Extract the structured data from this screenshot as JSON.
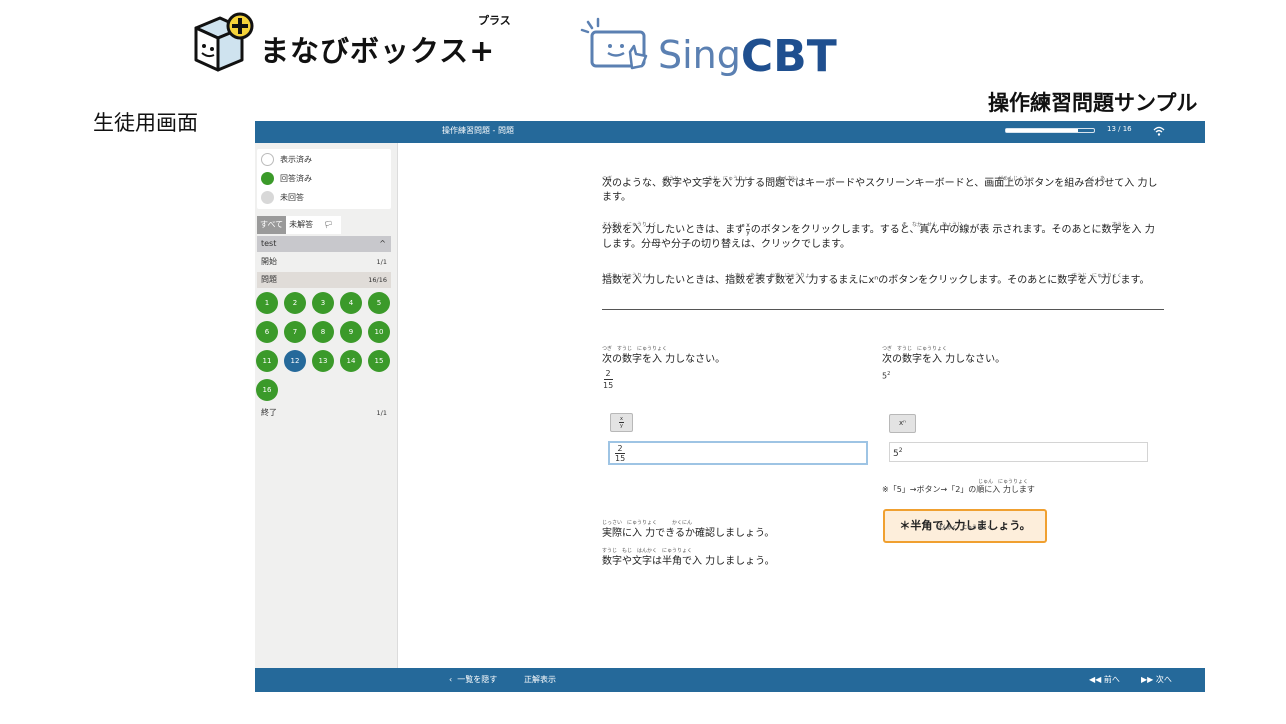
{
  "branding": {
    "manabi_text": "まなびボックス",
    "manabi_plus": "+",
    "manabi_ruby": "プラス",
    "sing_text": "Sing",
    "cbt_text": "CBT"
  },
  "sample_title": "操作練習問題サンプル",
  "student_label": "生徒用画面",
  "topbar": {
    "title": "操作練習問題 - 問題",
    "progress": 0.8125,
    "page_count": "13 / 16"
  },
  "sidebar": {
    "legend": [
      {
        "label": "表示済み",
        "color": "#ffffff"
      },
      {
        "label": "回答済み",
        "color": "#3b9a2a"
      },
      {
        "label": "未回答",
        "color": "#d8d8d8"
      }
    ],
    "tabs": [
      "すべて",
      "未解答",
      "🏳"
    ],
    "section": "test",
    "rows": [
      {
        "label": "開始",
        "count": "1/1"
      },
      {
        "label": "問題",
        "count": "16/16"
      },
      {
        "label": "終了",
        "count": "1/1"
      }
    ],
    "questions": [
      "1",
      "2",
      "3",
      "4",
      "5",
      "6",
      "7",
      "8",
      "9",
      "10",
      "11",
      "12",
      "13",
      "14",
      "15",
      "16"
    ],
    "current_question": "12"
  },
  "content": {
    "intro1": "次のような、数字や文字を入 力する問題ではキーボードやスクリーンキーボードと、画面上のボタンを組み合わせて入 力します。",
    "intro2a": "分数を入 力したいときは、まず",
    "intro2b": "のボタンをクリックします。すると、真ん中の線が表 示されます。そのあとに数字を入 力します。分母や分子の切り替えは、クリックでします。",
    "intro3": "指数を入 力したいときは、指数を表す数を入 力するまえにxⁿのボタンをクリックします。そのあとに数字を入 力します。",
    "q1_prompt": "次の数字を入 力しなさい。",
    "q1_num": "2",
    "q1_den": "15",
    "q1_btn_num": "x",
    "q1_btn_den": "y",
    "q1_answer_num": "2",
    "q1_answer_den": "15",
    "q2_prompt": "次の数字を入 力しなさい。",
    "q2_base": "5",
    "q2_exp": "2",
    "q2_btn": "xⁿ",
    "q2_answer_base": "5",
    "q2_answer_exp": "2",
    "note": "※「5」→ボタン→「2」の順に入 力します",
    "callout": "＊半角で入力しましょう。",
    "footer1": "実際に入 力できるか確認しましょう。",
    "footer2": "数字や文字は半角で入 力しましょう。"
  },
  "bottombar": {
    "hide_list": "一覧を隠す",
    "show_answer": "正解表示",
    "prev": "前へ",
    "next": "次へ"
  }
}
